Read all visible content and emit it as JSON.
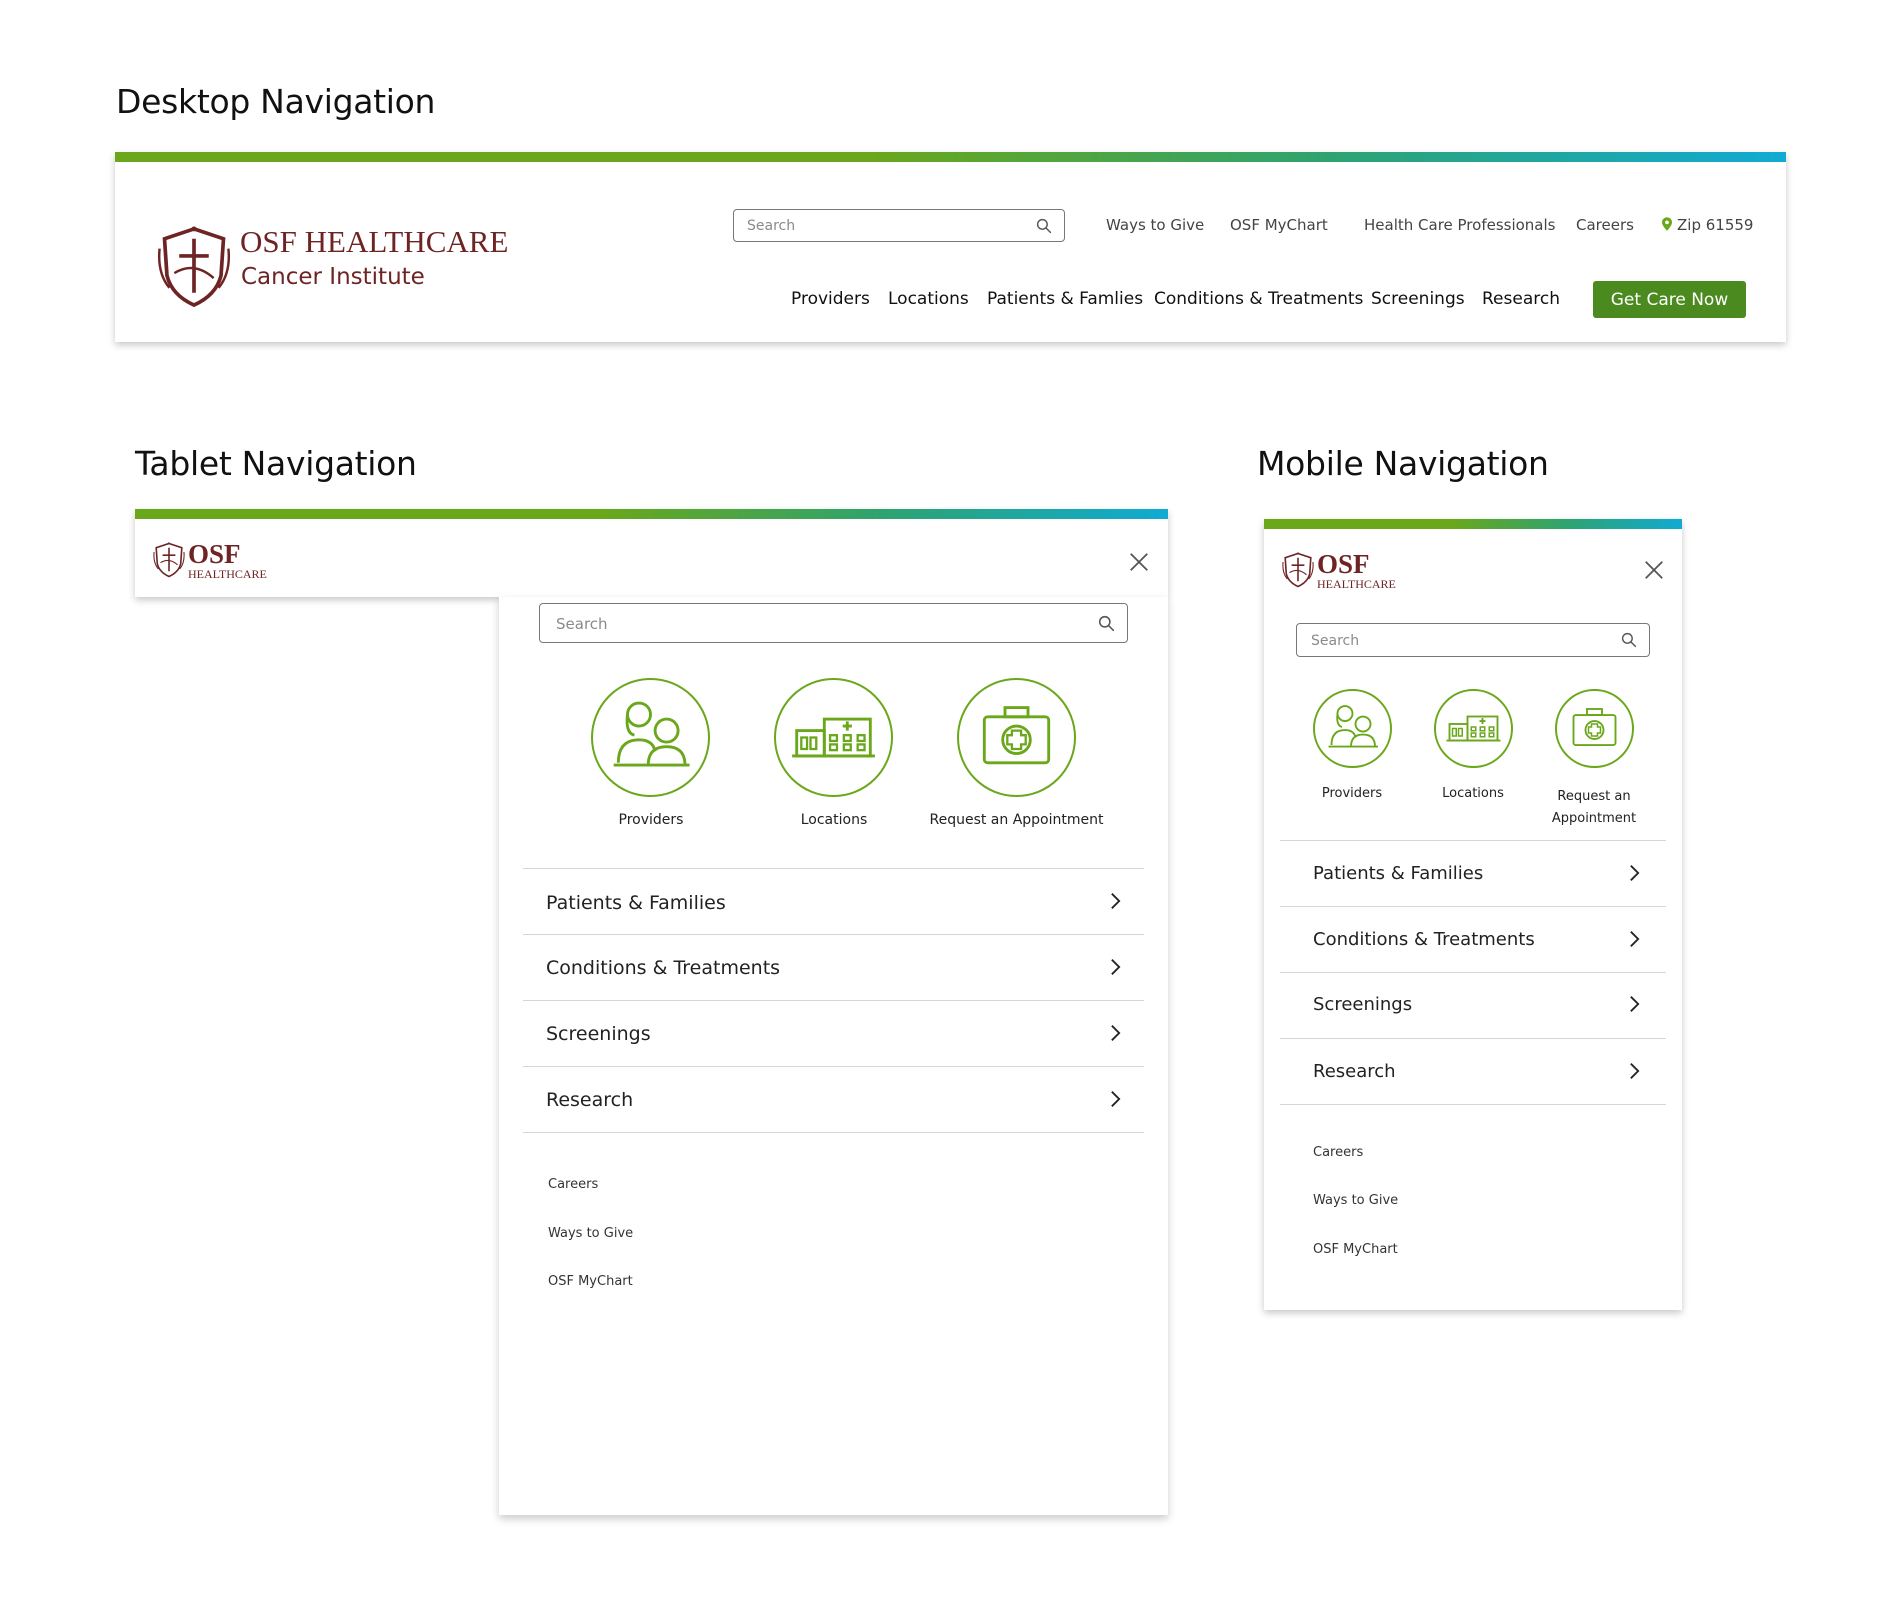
{
  "sections": {
    "desktop_title": "Desktop Navigation",
    "tablet_title": "Tablet Navigation",
    "mobile_title": "Mobile Navigation"
  },
  "brand": {
    "name": "OSF HEALTHCARE",
    "osf": "OSF",
    "healthcare": "HEALTHCARE",
    "subtitle": "Cancer Institute",
    "color": "#6e2424"
  },
  "colors": {
    "green": "#6aa71a",
    "cta_green": "#4b8a1e",
    "blue": "#10aad3"
  },
  "desktop": {
    "search_placeholder": "Search",
    "utility_links": [
      "Ways to Give",
      "OSF MyChart",
      "Health Care Professionals",
      "Careers"
    ],
    "zip_label": "Zip 61559",
    "main_links": [
      "Providers",
      "Locations",
      "Patients & Famlies",
      "Conditions & Treatments",
      "Screenings",
      "Research"
    ],
    "cta_label": "Get Care Now"
  },
  "tablet": {
    "search_placeholder": "Search",
    "quick_links": [
      "Providers",
      "Locations",
      "Request an Appointment"
    ],
    "menu_items": [
      "Patients & Families",
      "Conditions & Treatments",
      "Screenings",
      "Research"
    ],
    "secondary_links": [
      "Careers",
      "Ways to Give",
      "OSF MyChart"
    ]
  },
  "mobile": {
    "search_placeholder": "Search",
    "quick_links": [
      "Providers",
      "Locations",
      "Request an Appointment"
    ],
    "menu_items": [
      "Patients & Families",
      "Conditions & Treatments",
      "Screenings",
      "Research"
    ],
    "secondary_links": [
      "Careers",
      "Ways to Give",
      "OSF MyChart"
    ]
  }
}
